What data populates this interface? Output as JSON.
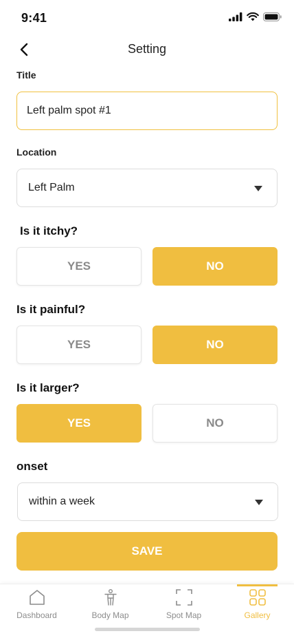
{
  "status_bar": {
    "time": "9:41"
  },
  "header": {
    "title": "Setting"
  },
  "title_field": {
    "label": "Title",
    "value": "Left palm spot #1"
  },
  "location_field": {
    "label": "Location",
    "value": "Left Palm"
  },
  "questions": [
    {
      "text": "Is it itchy?",
      "yes_label": "YES",
      "no_label": "NO",
      "selected": "NO"
    },
    {
      "text": "Is it painful?",
      "yes_label": "YES",
      "no_label": "NO",
      "selected": "NO"
    },
    {
      "text": "Is it larger?",
      "yes_label": "YES",
      "no_label": "NO",
      "selected": "YES"
    }
  ],
  "onset_field": {
    "label": "onset",
    "value": "within a week"
  },
  "save_label": "SAVE",
  "tabs": [
    {
      "label": "Dashboard",
      "icon": "home-icon",
      "active": false
    },
    {
      "label": "Body Map",
      "icon": "body-icon",
      "active": false
    },
    {
      "label": "Spot Map",
      "icon": "scan-icon",
      "active": false
    },
    {
      "label": "Gallery",
      "icon": "gallery-icon",
      "active": true
    }
  ],
  "colors": {
    "accent": "#f0be40",
    "inactive_text": "#8a8a8a",
    "border": "#dcdcdc"
  }
}
